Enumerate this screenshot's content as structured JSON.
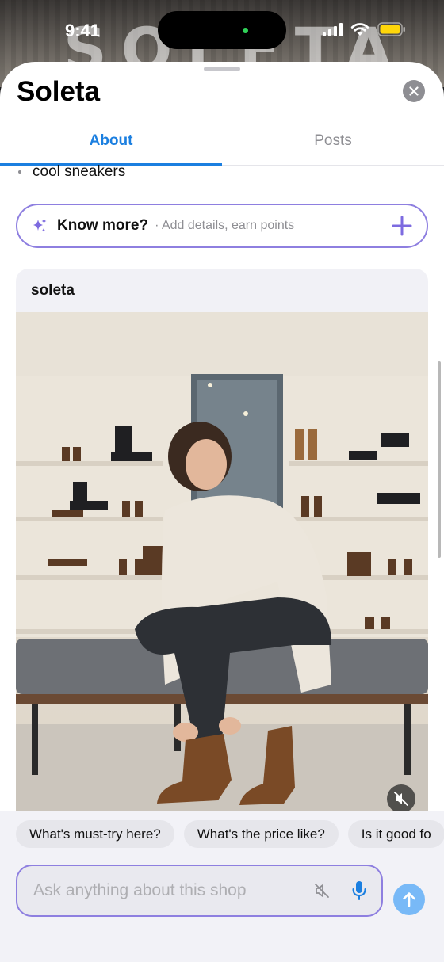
{
  "status_bar": {
    "time": "9:41"
  },
  "background": {
    "sign_text": "SOLETA"
  },
  "sheet": {
    "title": "Soleta",
    "tabs": [
      {
        "label": "About",
        "active": true
      },
      {
        "label": "Posts",
        "active": false
      }
    ],
    "bullets": [
      "cool sneakers"
    ],
    "know_more": {
      "title": "Know more?",
      "subtitle": "· Add details, earn points"
    },
    "card": {
      "header": "soleta"
    }
  },
  "suggestions": [
    "What's must-try here?",
    "What's the price like?",
    "Is it good fo"
  ],
  "composer": {
    "placeholder": "Ask anything about this shop"
  },
  "colors": {
    "accent_blue": "#1b7fe0",
    "outline_purple": "#8e7fe0",
    "send_blue": "#78b9f7"
  }
}
